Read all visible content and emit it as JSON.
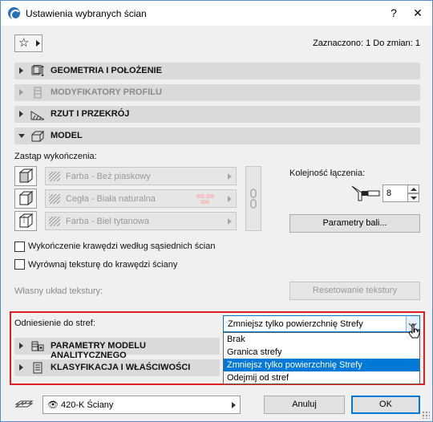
{
  "window": {
    "title": "Ustawienia wybranych ścian",
    "help_label": "?",
    "close_label": "✕"
  },
  "header": {
    "favorites_icon": "star-icon",
    "selection_info": "Zaznaczono: 1 Do zmian: 1"
  },
  "sections": {
    "geometry": "GEOMETRIA I POŁOŻENIE",
    "modifiers": "MODYFIKATORY PROFILU",
    "plan": "RZUT I PRZEKRÓJ",
    "model": "MODEL",
    "analytical": "PARAMETRY MODELU ANALITYCZNEGO",
    "classification": "KLASYFIKACJA I WŁAŚCIWOŚCI"
  },
  "model": {
    "override_label": "Zastąp wykończenia:",
    "surfaces": [
      {
        "label": "Farba - Beż piaskowy"
      },
      {
        "label": "Cegła - Biała naturalna"
      },
      {
        "label": "Farba - Biel tytanowa"
      }
    ],
    "connection_order_label": "Kolejność łączenia:",
    "connection_order_value": "8",
    "beam_params_button": "Parametry bali...",
    "edge_surface_checkbox": "Wykończenie krawędzi według sąsiednich ścian",
    "align_texture_checkbox": "Wyrównaj teksturę do krawędzi ściany",
    "custom_texture_label": "Własny układ tekstury:",
    "reset_texture_button": "Resetowanie tekstury",
    "zones_label": "Odniesienie do stref:",
    "zones_selected": "Zmniejsz tylko powierzchnię Strefy",
    "zones_options": [
      "Brak",
      "Granica strefy",
      "Zmniejsz tylko powierzchnię Strefy",
      "Odejmij od stref"
    ],
    "zones_selected_index": 2
  },
  "footer": {
    "layer": "420-K Ściany",
    "cancel_button": "Anuluj",
    "ok_button": "OK"
  },
  "colors": {
    "accent": "#0078d7",
    "highlight_frame": "#e02020",
    "section_bg": "#dadada"
  }
}
